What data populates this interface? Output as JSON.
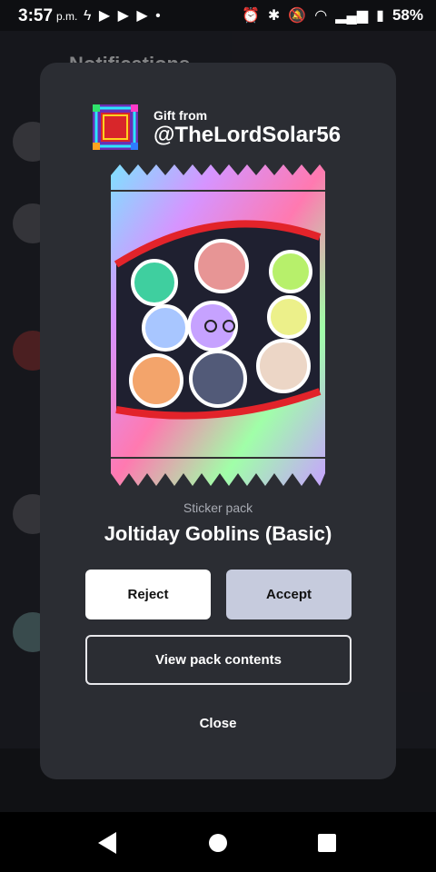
{
  "status_bar": {
    "time": "3:57",
    "ampm": "p.m.",
    "left_icons": "ϟ ▶ ▶ ▶ •",
    "right_icons": [
      "alarm-icon",
      "bluetooth-icon",
      "mute-icon",
      "wifi-icon",
      "signal-icon",
      "battery-icon"
    ],
    "battery": "58%"
  },
  "background": {
    "title": "Notifications"
  },
  "modal": {
    "gift_label": "Gift from",
    "gift_user": "@TheLordSolar56",
    "pack_type": "Sticker pack",
    "pack_name": "Joltiday Goblins (Basic)",
    "reject_label": "Reject",
    "accept_label": "Accept",
    "view_label": "View pack contents",
    "close_label": "Close"
  },
  "colors": {
    "modal_bg": "#2b2d33",
    "accept_bg": "#c6cbdd",
    "reject_bg": "#ffffff"
  }
}
